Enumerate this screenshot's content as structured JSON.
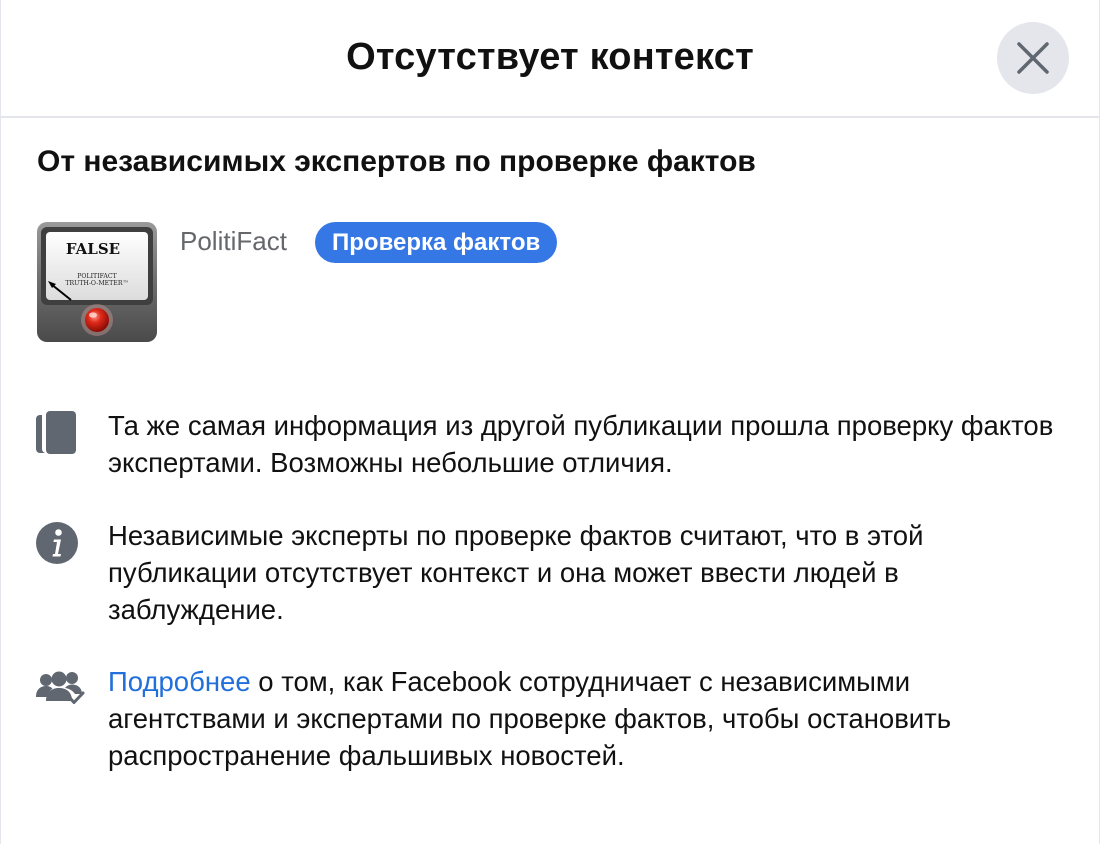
{
  "dialog": {
    "title": "Отсутствует контекст",
    "close_icon": "close-x-icon"
  },
  "section": {
    "subtitle": "От независимых экспертов по проверке фактов"
  },
  "source": {
    "image_icon": "truth-o-meter-false-image",
    "rating": "FALSE",
    "meter_caption_line1": "POLITIFACT",
    "meter_caption_line2": "TRUTH-O-METER™",
    "name": "PolitiFact",
    "badge": "Проверка фактов"
  },
  "notes": [
    {
      "icon": "copy-icon",
      "text": "Та же самая информация из другой публикации прошла проверку фактов экспертами. Возможны небольшие отличия."
    },
    {
      "icon": "info-icon",
      "text": "Независимые эксперты по проверке фактов считают, что в этой публикации отсутствует контекст и она может ввести людей в заблуждение."
    },
    {
      "icon": "people-check-icon",
      "link": "Подробнее",
      "text": " о том, как Facebook сотрудничает с независимыми агентствами и экспертами по проверке фактов, чтобы остановить распространение фальшивых новостей."
    }
  ],
  "colors": {
    "accent": "#3578e5",
    "link": "#216fdb",
    "secondary_text": "#65676b",
    "icon_gray": "#606770",
    "divider": "#e4e6eb"
  }
}
